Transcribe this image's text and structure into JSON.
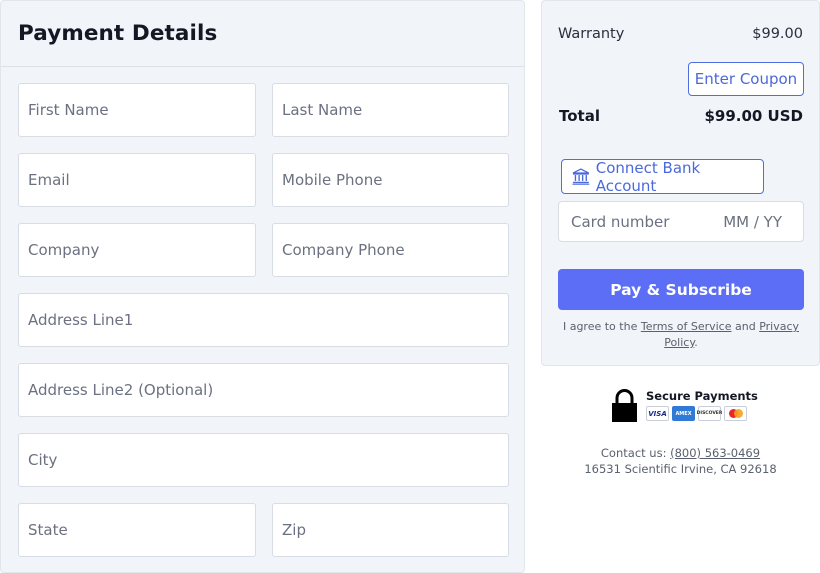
{
  "payment": {
    "title": "Payment Details",
    "fields": {
      "first_name": "First Name",
      "last_name": "Last Name",
      "email": "Email",
      "mobile_phone": "Mobile Phone",
      "company": "Company",
      "company_phone": "Company Phone",
      "address_line1": "Address Line1",
      "address_line2": "Address Line2 (Optional)",
      "city": "City",
      "state": "State",
      "zip": "Zip"
    }
  },
  "summary": {
    "item_label": "Warranty",
    "item_price": "$99.00",
    "coupon_label": "Enter Coupon",
    "total_label": "Total",
    "total_value": "$99.00 USD",
    "bank_label": "Connect Bank Account",
    "card_number_placeholder": "Card number",
    "card_exp_placeholder": "MM / YY",
    "pay_label": "Pay & Subscribe",
    "agree_prefix": "I agree to the",
    "terms_label": "Terms of Service",
    "agree_and": "and",
    "privacy_label": "Privacy Policy",
    "agree_suffix": "."
  },
  "secure": {
    "title": "Secure Payments",
    "cards": [
      "VISA",
      "AMEX",
      "DISCOVER",
      "Mastercard"
    ],
    "icons": [
      "lock-icon",
      "visa-icon",
      "amex-icon",
      "discover-icon",
      "mastercard-icon",
      "bank-icon"
    ]
  },
  "contact": {
    "label": "Contact us:",
    "phone": "(800) 563-0469",
    "address": "16531 Scientific Irvine, CA 92618"
  },
  "colors": {
    "accent": "#5b6ef5",
    "outline_blue": "#4b69d9",
    "panel_bg": "#f1f4f9"
  }
}
